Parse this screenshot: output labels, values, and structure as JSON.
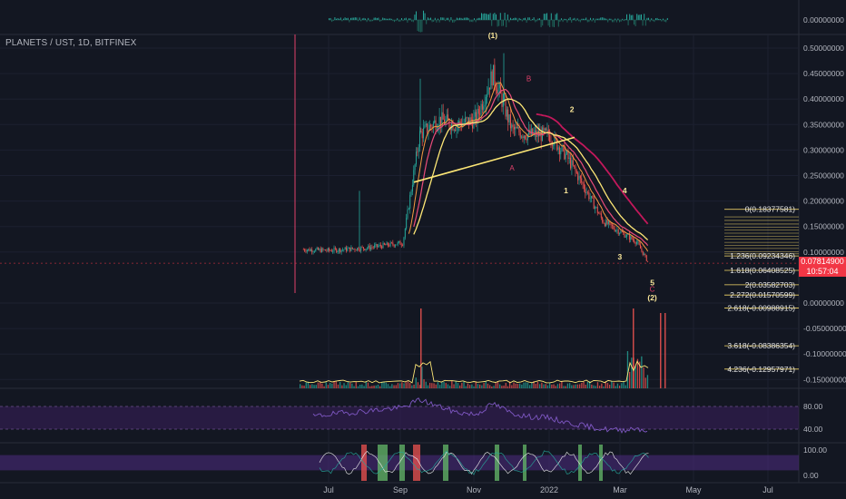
{
  "symbol_title": "PLANETS / UST, 1D, BITFINEX",
  "last_price": "0.07814900",
  "countdown": "10:57:04",
  "colors": {
    "background": "#131722",
    "up": "#26a69a",
    "down": "#ef5350",
    "wave_label": "#fbe89a",
    "corrective_label": "#e0416b",
    "price_tag": "#f23645",
    "fib_line": "#f5d86a",
    "rsi_band": "#3b1f5c",
    "stoch_band": "#4a2a7a"
  },
  "chart_data": [
    {
      "type": "line",
      "panel": "main-price",
      "y_axis_ticks": [
        "0.50000000",
        "0.45000000",
        "0.40000000",
        "0.35000000",
        "0.30000000",
        "0.25000000",
        "0.20000000",
        "0.15000000",
        "0.10000000",
        "0.00000000",
        "-0.05000000",
        "-0.10000000",
        "-0.15000000"
      ],
      "y_axis_values": [
        0.5,
        0.45,
        0.4,
        0.35,
        0.3,
        0.25,
        0.2,
        0.15,
        0.1,
        0.0,
        -0.05,
        -0.1,
        -0.15
      ],
      "ylim": [
        -0.17,
        0.53
      ],
      "x_axis_ticks": [
        "Jul",
        "Sep",
        "Nov",
        "2022",
        "Mar",
        "May",
        "Jul"
      ],
      "x": [
        "Jun 10",
        "Jul 1",
        "Aug 1",
        "Sep 1",
        "Sep 15",
        "Oct 1",
        "Oct 15",
        "Nov 1",
        "Nov 15",
        "Dec 1",
        "Dec 15",
        "Jan 1",
        "Jan 15",
        "Feb 1",
        "Feb 15",
        "Mar 1",
        "Mar 15",
        "Mar 25"
      ],
      "series": [
        {
          "values": [
            0.105,
            0.103,
            0.108,
            0.118,
            0.33,
            0.36,
            0.35,
            0.36,
            0.45,
            0.34,
            0.33,
            0.33,
            0.29,
            0.22,
            0.16,
            0.14,
            0.12,
            0.078
          ]
        }
      ],
      "wave_labels": [
        {
          "text": "(1)",
          "x": "Nov 15",
          "y": 0.52
        },
        {
          "text": "2",
          "x": "Jan 20",
          "y": 0.375
        },
        {
          "text": "1",
          "x": "Jan 15",
          "y": 0.215
        },
        {
          "text": "3",
          "x": "Mar 1",
          "y": 0.085
        },
        {
          "text": "4",
          "x": "Mar 5",
          "y": 0.215
        },
        {
          "text": "5",
          "x": "Mar 28",
          "y": 0.035
        },
        {
          "text": "(2)",
          "x": "Mar 28",
          "y": 0.005
        }
      ],
      "corrective_labels": [
        {
          "text": "B",
          "x": "Dec 15",
          "y": 0.435
        },
        {
          "text": "A",
          "x": "Dec 1",
          "y": 0.26
        },
        {
          "text": "C",
          "x": "Mar 28",
          "y": 0.022
        }
      ],
      "fib_levels": [
        {
          "label": "0(0.18377581)",
          "value": 0.18377581
        },
        {
          "label": "1.236(0.09234346)",
          "value": 0.09234346
        },
        {
          "label": "1.618(0.06408525)",
          "value": 0.06408525
        },
        {
          "label": "2(0.03582703)",
          "value": 0.03582703
        },
        {
          "label": "2.272(0.01570599)",
          "value": 0.01570599
        },
        {
          "label": "2.618(-0.00988915)",
          "value": -0.00988915
        },
        {
          "label": "3.618(-0.08386354)",
          "value": -0.08386354
        },
        {
          "label": "4.236(-0.12957971)",
          "value": -0.12957971
        }
      ]
    },
    {
      "type": "bar",
      "panel": "top-histogram",
      "y_axis_ticks": [
        "0.00000000"
      ]
    },
    {
      "type": "line",
      "panel": "rsi",
      "y_axis_ticks": [
        "80.00",
        "40.00"
      ],
      "ylim": [
        20,
        100
      ],
      "x": [
        "Jun 10",
        "Jul 1",
        "Aug 1",
        "Sep 1",
        "Sep 15",
        "Oct 1",
        "Oct 15",
        "Nov 1",
        "Nov 15",
        "Dec 1",
        "Dec 15",
        "Jan 1",
        "Jan 15",
        "Feb 1",
        "Feb 15",
        "Mar 1",
        "Mar 15",
        "Mar 25"
      ],
      "series": [
        {
          "values": [
            60,
            66,
            72,
            78,
            92,
            80,
            70,
            66,
            85,
            68,
            62,
            60,
            52,
            45,
            40,
            38,
            42,
            36
          ]
        }
      ]
    },
    {
      "type": "line",
      "panel": "stochastic",
      "y_axis_ticks": [
        "100.00",
        "0.00"
      ],
      "ylim": [
        -5,
        105
      ]
    }
  ]
}
